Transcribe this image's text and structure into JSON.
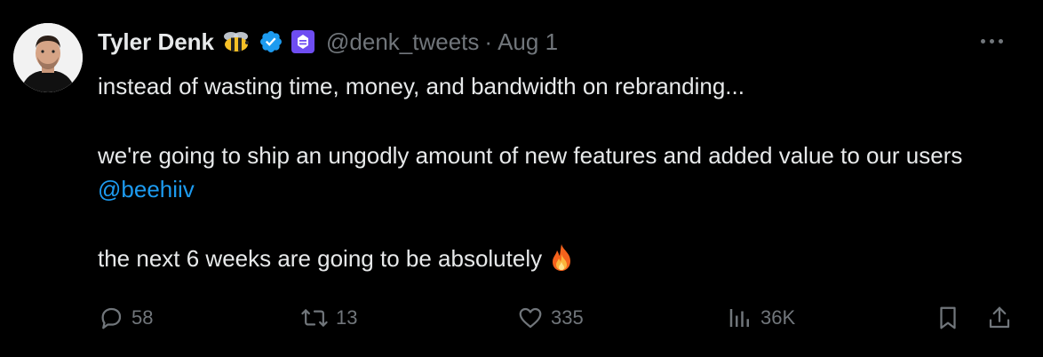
{
  "tweet": {
    "author_name": "Tyler Denk",
    "handle": "@denk_tweets",
    "separator": "·",
    "date": "Aug 1",
    "badges": [
      "bee-emoji",
      "verified-badge-icon",
      "beehiiv-affiliate-icon"
    ],
    "body": {
      "line1": "instead of wasting time, money, and bandwidth on rebranding...",
      "line2_before_mention": "we're going to ship an ungodly amount of new features and added value to our users ",
      "mention": "@beehiiv",
      "line3": "the next 6 weeks are going to be absolutely",
      "emoji": "🔥"
    },
    "stats": {
      "replies": "58",
      "retweets": "13",
      "likes": "335",
      "views": "36K"
    }
  },
  "colors": {
    "background": "#000000",
    "text": "#e7e9ea",
    "muted": "#71767b",
    "link": "#1d9bf0",
    "verified": "#1d9bf0",
    "affiliate": "#6e4df2"
  }
}
